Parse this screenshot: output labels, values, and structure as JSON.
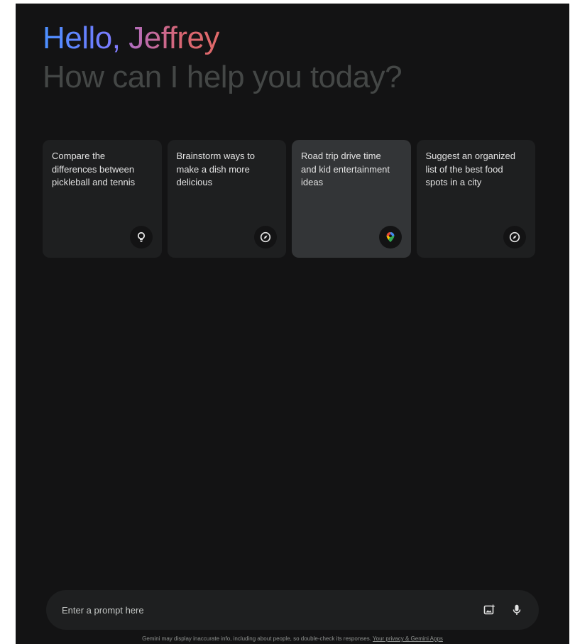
{
  "greeting": {
    "hello": "Hello, ",
    "name": "Jeffrey"
  },
  "subtitle": "How can I help you today?",
  "cards": [
    {
      "text": "Compare the differences between pickleball and tennis",
      "icon": "lightbulb-icon"
    },
    {
      "text": "Brainstorm ways to make a dish more delicious",
      "icon": "compass-icon"
    },
    {
      "text": "Road trip drive time and kid entertainment ideas",
      "icon": "maps-pin-icon"
    },
    {
      "text": "Suggest an organized list of the best food spots in a city",
      "icon": "compass-icon"
    }
  ],
  "prompt": {
    "placeholder": "Enter a prompt here"
  },
  "footer": {
    "disclaimer": "Gemini may display inaccurate info, including about people, so double-check its responses. ",
    "link": "Your privacy & Gemini Apps"
  },
  "colors": {
    "background": "#131314",
    "card": "#1e1f20",
    "card_active": "#333537",
    "hello_gradient": [
      "#4b90ff",
      "#8d7bff"
    ],
    "name_gradient": [
      "#b06ec4",
      "#e06a6a"
    ]
  }
}
